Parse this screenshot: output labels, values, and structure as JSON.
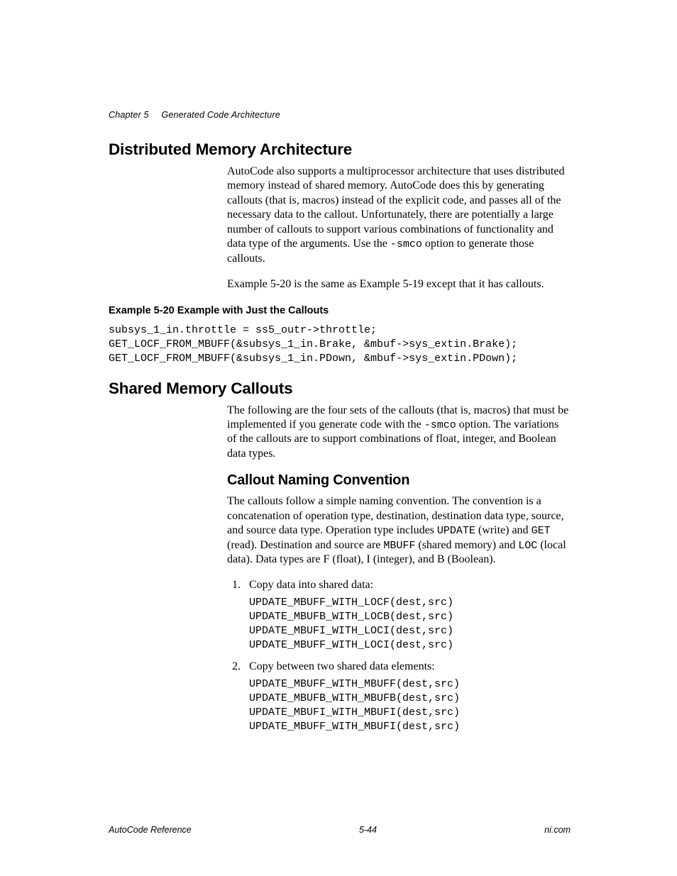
{
  "header": {
    "chapter": "Chapter 5",
    "title": "Generated Code Architecture"
  },
  "section1": {
    "heading": "Distributed Memory Architecture",
    "p1_a": "AutoCode also supports a multiprocessor architecture that uses distributed memory instead of shared memory. AutoCode does this by generating callouts (that is, macros) instead of the explicit code, and passes all of the necessary data to the callout. Unfortunately, there are potentially a large number of callouts to support various combinations of functionality and data type of the arguments. Use the ",
    "p1_code": "-smco",
    "p1_b": " option to generate those callouts.",
    "p2": "Example 5-20 is the same as Example 5-19 except that it has callouts.",
    "example_label": "Example 5-20     Example with Just the Callouts",
    "code": "subsys_1_in.throttle = ss5_outr->throttle;\nGET_LOCF_FROM_MBUFF(&subsys_1_in.Brake, &mbuf->sys_extin.Brake);\nGET_LOCF_FROM_MBUFF(&subsys_1_in.PDown, &mbuf->sys_extin.PDown);"
  },
  "section2": {
    "heading": "Shared Memory Callouts",
    "p1_a": "The following are the four sets of the callouts (that is, macros) that must be implemented if you generate code with the ",
    "p1_code": "-smco",
    "p1_b": " option. The variations of the callouts are to support combinations of float, integer, and Boolean data types.",
    "sub": {
      "heading": "Callout Naming Convention",
      "p1_a": "The callouts follow a simple naming convention. The convention is a concatenation of operation type, destination, destination data type, source, and source data type. Operation type includes ",
      "p1_c1": "UPDATE",
      "p1_b": " (write) and ",
      "p1_c2": "GET",
      "p1_c": " (read). Destination and source are ",
      "p1_c3": "MBUFF",
      "p1_d": " (shared memory) and ",
      "p1_c4": "LOC",
      "p1_e": " (local data). Data types are F (float), I (integer), and B (Boolean).",
      "list": {
        "item1": "Copy data into shared data:",
        "code1": "UPDATE_MBUFF_WITH_LOCF(dest,src)\nUPDATE_MBUFB_WITH_LOCB(dest,src)\nUPDATE_MBUFI_WITH_LOCI(dest,src)\nUPDATE_MBUFF_WITH_LOCI(dest,src)",
        "item2": "Copy between two shared data elements:",
        "code2": "UPDATE_MBUFF_WITH_MBUFF(dest,src)\nUPDATE_MBUFB_WITH_MBUFB(dest,src)\nUPDATE_MBUFI_WITH_MBUFI(dest,src)\nUPDATE_MBUFF_WITH_MBUFI(dest,src)"
      }
    }
  },
  "footer": {
    "left": "AutoCode Reference",
    "center": "5-44",
    "right": "ni.com"
  }
}
